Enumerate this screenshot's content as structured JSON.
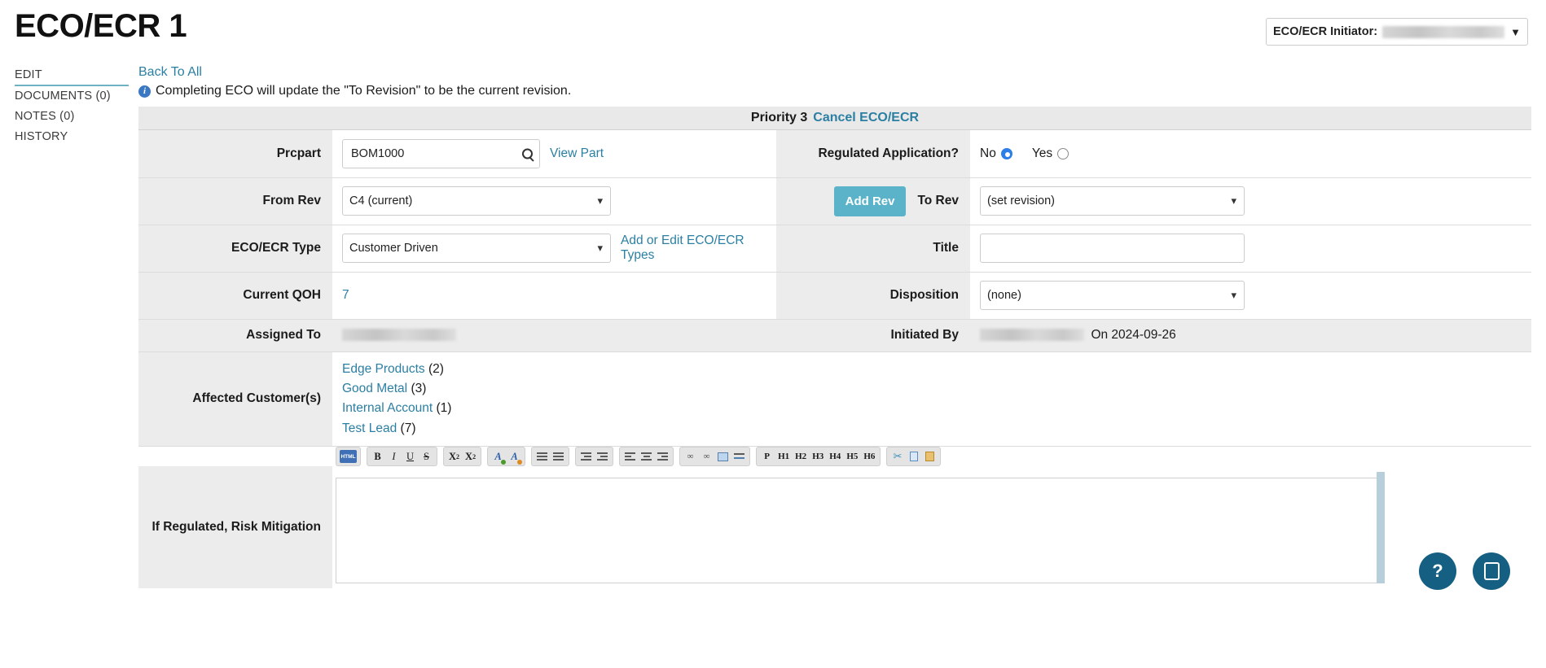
{
  "header": {
    "title": "ECO/ECR 1",
    "initiator_label": "ECO/ECR Initiator:",
    "initiator_value": "",
    "caret": "▼"
  },
  "sidebar": {
    "items": [
      {
        "label": "EDIT",
        "active": true
      },
      {
        "label": "DOCUMENTS (0)",
        "active": false
      },
      {
        "label": "NOTES (0)",
        "active": false
      },
      {
        "label": "HISTORY",
        "active": false
      }
    ]
  },
  "main": {
    "back_link": "Back To All",
    "notice": "Completing ECO will update the \"To Revision\" to be the current revision.",
    "priority_text": "Priority 3",
    "cancel_link": "Cancel ECO/ECR"
  },
  "form": {
    "prcpart": {
      "label": "Prcpart",
      "value": "BOM1000",
      "placeholder": "",
      "view_part_link": "View Part"
    },
    "regulated": {
      "label": "Regulated Application?",
      "no_label": "No",
      "yes_label": "Yes",
      "selected": "No"
    },
    "from_rev": {
      "label": "From Rev",
      "value": "C4 (current)",
      "options": [
        "C4 (current)"
      ]
    },
    "add_rev_button": "Add Rev",
    "to_rev": {
      "label": "To Rev",
      "value": "(set revision)",
      "options": [
        "(set revision)"
      ]
    },
    "eco_type": {
      "label": "ECO/ECR Type",
      "value": "Customer Driven",
      "options": [
        "Customer Driven"
      ],
      "edit_link": "Add or Edit ECO/ECR Types"
    },
    "title": {
      "label": "Title",
      "value": "",
      "placeholder": ""
    },
    "current_qoh": {
      "label": "Current QOH",
      "value": "7"
    },
    "disposition": {
      "label": "Disposition",
      "value": "(none)",
      "options": [
        "(none)"
      ]
    },
    "assigned_to": {
      "label": "Assigned To",
      "value": ""
    },
    "initiated_by": {
      "label": "Initiated By",
      "value": "",
      "on_date": "On 2024-09-26"
    },
    "affected_customers": {
      "label": "Affected Customer(s)",
      "items": [
        {
          "name": "Edge Products",
          "count": "(2)"
        },
        {
          "name": "Good Metal",
          "count": "(3)"
        },
        {
          "name": "Internal Account",
          "count": "(1)"
        },
        {
          "name": "Test Lead",
          "count": "(7)"
        }
      ]
    },
    "risk_mitigation": {
      "label": "If Regulated, Risk Mitigation",
      "value": ""
    }
  },
  "editor_toolbar": {
    "groups": [
      {
        "buttons": [
          {
            "name": "source-html-icon",
            "glyph": "HTML",
            "kind": "src"
          }
        ]
      },
      {
        "buttons": [
          {
            "name": "bold-icon",
            "glyph": "B",
            "kind": "b"
          },
          {
            "name": "italic-icon",
            "glyph": "I",
            "kind": "i"
          },
          {
            "name": "underline-icon",
            "glyph": "U",
            "kind": "u"
          },
          {
            "name": "strikethrough-icon",
            "glyph": "S",
            "kind": "s"
          }
        ]
      },
      {
        "buttons": [
          {
            "name": "subscript-icon",
            "glyph": "X₂",
            "kind": "t"
          },
          {
            "name": "superscript-icon",
            "glyph": "X²",
            "kind": "t"
          }
        ]
      },
      {
        "buttons": [
          {
            "name": "text-color-icon",
            "glyph": "A",
            "kind": "colA-g"
          },
          {
            "name": "background-color-icon",
            "glyph": "A",
            "kind": "colA-o"
          }
        ]
      },
      {
        "buttons": [
          {
            "name": "numbered-list-icon",
            "glyph": "list",
            "kind": "ol"
          },
          {
            "name": "bulleted-list-icon",
            "glyph": "list",
            "kind": "ul"
          }
        ]
      },
      {
        "buttons": [
          {
            "name": "outdent-icon",
            "glyph": "out",
            "kind": "ind"
          },
          {
            "name": "indent-icon",
            "glyph": "in",
            "kind": "ind"
          }
        ]
      },
      {
        "buttons": [
          {
            "name": "align-left-icon",
            "glyph": "al",
            "kind": "al"
          },
          {
            "name": "align-center-icon",
            "glyph": "ac",
            "kind": "ac"
          },
          {
            "name": "align-right-icon",
            "glyph": "ar",
            "kind": "ar"
          }
        ]
      },
      {
        "buttons": [
          {
            "name": "insert-link-icon",
            "glyph": "∞",
            "kind": "lnk"
          },
          {
            "name": "unlink-icon",
            "glyph": "∞",
            "kind": "ulnk"
          },
          {
            "name": "insert-image-icon",
            "glyph": "img",
            "kind": "img"
          },
          {
            "name": "horizontal-rule-icon",
            "glyph": "hr",
            "kind": "hr"
          }
        ]
      },
      {
        "buttons": [
          {
            "name": "format-paragraph-icon",
            "glyph": "P",
            "kind": "hd"
          },
          {
            "name": "format-h1-icon",
            "glyph": "H1",
            "kind": "hd"
          },
          {
            "name": "format-h2-icon",
            "glyph": "H2",
            "kind": "hd"
          },
          {
            "name": "format-h3-icon",
            "glyph": "H3",
            "kind": "hd"
          },
          {
            "name": "format-h4-icon",
            "glyph": "H4",
            "kind": "hd"
          },
          {
            "name": "format-h5-icon",
            "glyph": "H5",
            "kind": "hd"
          },
          {
            "name": "format-h6-icon",
            "glyph": "H6",
            "kind": "hd"
          }
        ]
      },
      {
        "buttons": [
          {
            "name": "cut-icon",
            "glyph": "✂",
            "kind": "cut"
          },
          {
            "name": "copy-icon",
            "glyph": "copy",
            "kind": "copy"
          },
          {
            "name": "paste-icon",
            "glyph": "paste",
            "kind": "paste"
          }
        ]
      }
    ]
  },
  "floating": {
    "help_glyph": "?",
    "chat_name": "chat-icon"
  }
}
